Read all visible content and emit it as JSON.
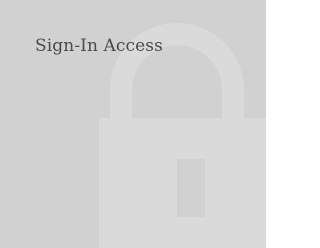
{
  "tile": {
    "title": "Sign-In Access",
    "icon": "lock-icon"
  },
  "colors": {
    "background": "#d1d1d1",
    "icon": "#dadada",
    "keyhole": "#d1d1d1",
    "text": "#4a4a4a"
  }
}
